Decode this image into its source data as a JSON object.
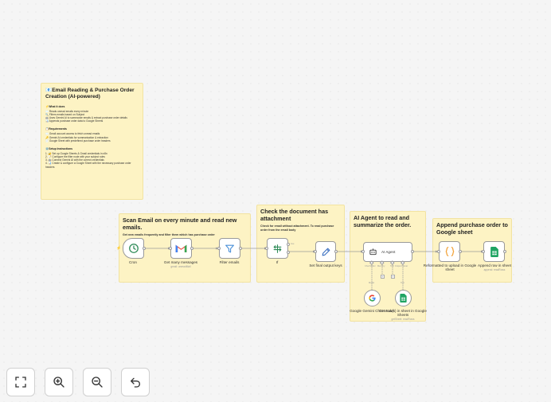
{
  "main_note": {
    "title": "📧Email Reading & Purchase Order Creation (AI-powered)",
    "what_title": "⚡What it does",
    "what_items": [
      "✉️ Reads unread emails every minute",
      "🔍 Filters emails based on Subject",
      "🤖 Uses Gemini AI to summarize emails & extract purchase order details",
      "📊 Appends purchase order data to Google Sheets"
    ],
    "req_title": "📋Requirements",
    "req_items": [
      "✉️ Gmail account access to fetch unread emails",
      "🔑 Gemini AI credentials for summarization & extraction",
      "📄 Google Sheet with predefined purchase order headers"
    ],
    "setup_title": "⚙️Setup Instructions",
    "setup_items": [
      "1. 🔐 Set up Google Sheets & Gmail credentials in n8n",
      "2. 📝 Configure the filter node with your subject rules",
      "3. 🤖 Connect Gemini AI with the correct credentials",
      "4. 📊 Create & configure a Google Sheet with the necessary purchase order headers"
    ]
  },
  "notes": {
    "scan_title": "Scan Email on every minute and read new emails.",
    "scan_sub": "Get new emails frequently and filter them which has purchase order",
    "check_title": "Check the document has attachment",
    "check_sub": "Check for email without attachment. To read purchase order from the email body",
    "agent_title": "AI Agent to read and summarize the order.",
    "append_title": "Append purchase order to Google sheet"
  },
  "nodes": {
    "cron": "Cron",
    "get_messages": "Get many messages",
    "get_messages_sub": "gmail: unreadMail",
    "filter": "Filter emails",
    "if": "If",
    "set_keys": "Set final output keys",
    "agent": "AI Agent",
    "gemini": "Google Gemini Chat Model",
    "get_rows": "Get row(s) in sheet in Google Sheets",
    "get_rows_sub": "getSheet: readRows",
    "reformat": "Reformatted to upload in Google sheet",
    "append": "Append row in sheet",
    "append_sub": "append: readRows"
  },
  "ports": {
    "chat_model": "Chat Model",
    "memory": "Memory",
    "tool": "Tool",
    "output_parser": "Output Parser",
    "true_label": "true",
    "false_label": "false"
  },
  "toolbar": {
    "fit": "fit-view-icon",
    "zoom_in": "zoom-in-icon",
    "zoom_out": "zoom-out-icon",
    "undo": "undo-icon"
  },
  "colors": {
    "sticky": "#fdf3c4",
    "gmail_red": "#ea4335",
    "sheets_green": "#1fa463",
    "filter_blue": "#4a90d9",
    "set_blue": "#3a6fc0",
    "cron_green": "#2e8b57",
    "code_orange": "#f2a33a"
  }
}
